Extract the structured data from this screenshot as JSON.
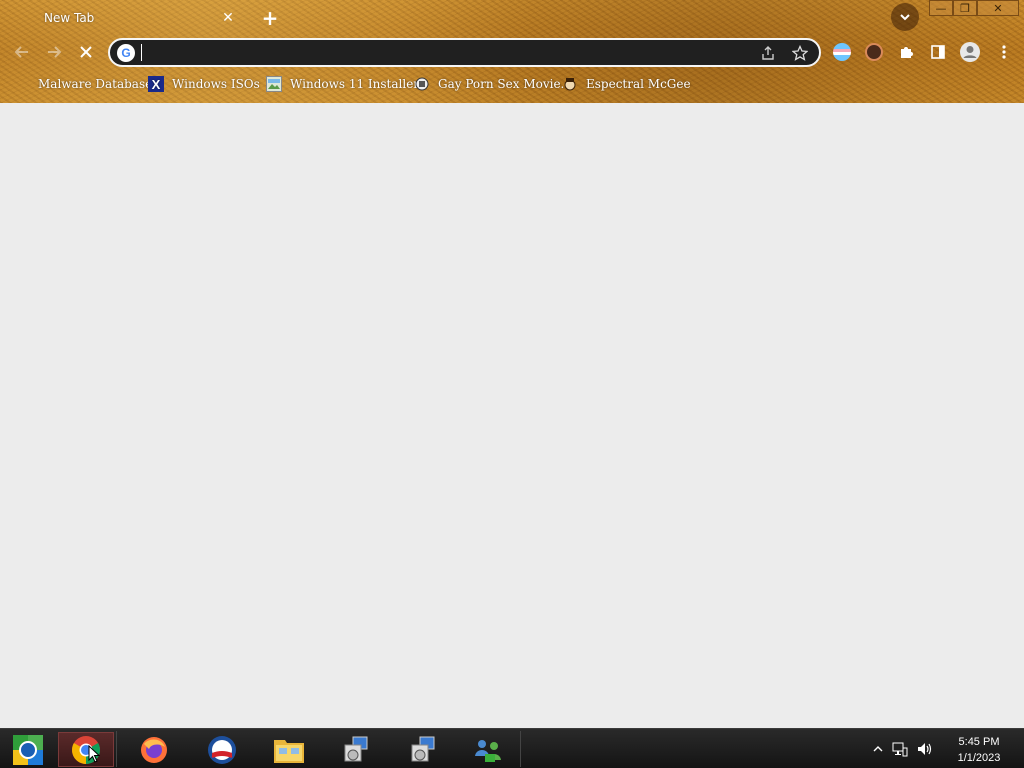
{
  "browser": {
    "tab": {
      "title": "New Tab",
      "close_glyph": "✕"
    },
    "new_tab_glyph": "+",
    "tab_search_icon": "chevron-down-icon",
    "window_controls": {
      "minimize": "—",
      "restore": "❐",
      "close": "✕"
    },
    "toolbar": {
      "back_icon": "arrow-left-icon",
      "forward_icon": "arrow-right-icon",
      "stop_icon": "close-icon"
    },
    "omnibox": {
      "value": "",
      "placeholder": ""
    },
    "extensions": [
      "translate-icon",
      "avatar-extension-icon",
      "puzzle-extensions-icon",
      "side-panel-icon",
      "profile-icon",
      "more-menu-icon"
    ]
  },
  "bookmarks": [
    {
      "label": "Malware Database",
      "icon": "folder-icon"
    },
    {
      "label": "Windows ISOs",
      "icon": "x-logo-icon"
    },
    {
      "label": "Windows 11 Installer",
      "icon": "image-icon"
    },
    {
      "label": "Gay Porn Sex Movie...",
      "icon": "game-icon"
    },
    {
      "label": "Espectral McGee",
      "icon": "character-icon"
    }
  ],
  "taskbar": {
    "items": [
      "start-orb-icon",
      "chrome-icon",
      "firefox-icon",
      "obama-logo-icon",
      "file-explorer-icon",
      "installer-icon",
      "installer-icon-2",
      "network-users-icon"
    ],
    "clock": {
      "time": "5:45 PM",
      "date": "1/1/2023"
    }
  },
  "colors": {
    "chrome_accent": "#c18528",
    "page_bg": "#ececec",
    "omnibox_bg": "#202020"
  }
}
